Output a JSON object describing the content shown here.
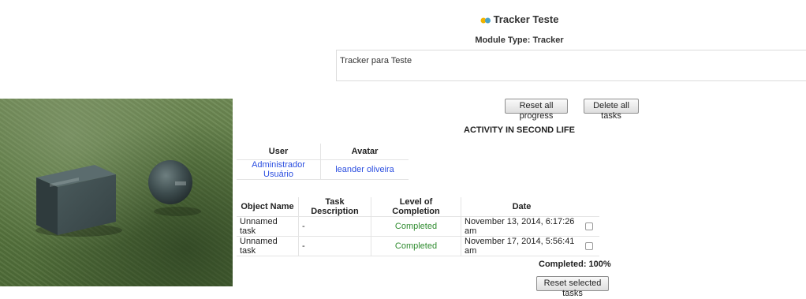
{
  "module": {
    "title": "Tracker Teste",
    "module_type": "Module Type: Tracker",
    "description": "Tracker para Teste",
    "icon": "tracker-module-icon"
  },
  "buttons": {
    "reset_all": "Reset all progress",
    "delete_all": "Delete all tasks",
    "reset_selected": "Reset selected tasks"
  },
  "activity": {
    "heading": "ACTIVITY IN SECOND LIFE",
    "columns": {
      "user": "User",
      "avatar": "Avatar"
    },
    "rows": [
      {
        "user": "Administrador Usuário",
        "avatar": "leander oliveira"
      }
    ]
  },
  "tasks": {
    "columns": {
      "object_name": "Object Name",
      "task_description": "Task Description",
      "level": "Level of Completion",
      "date": "Date"
    },
    "rows": [
      {
        "object_name": "Unnamed task",
        "description": "-",
        "level": "Completed",
        "date": "November 13, 2014, 6:17:26 am",
        "checked": false
      },
      {
        "object_name": "Unnamed task",
        "description": "-",
        "level": "Completed",
        "date": "November 17, 2014, 5:56:41 am",
        "checked": false
      }
    ]
  },
  "summary": {
    "completed": "Completed: 100%"
  },
  "colors": {
    "link": "#2b4ee0",
    "completed": "#2e8b2e",
    "grass": "#5f7d45",
    "objects": "#3f4e4f"
  }
}
